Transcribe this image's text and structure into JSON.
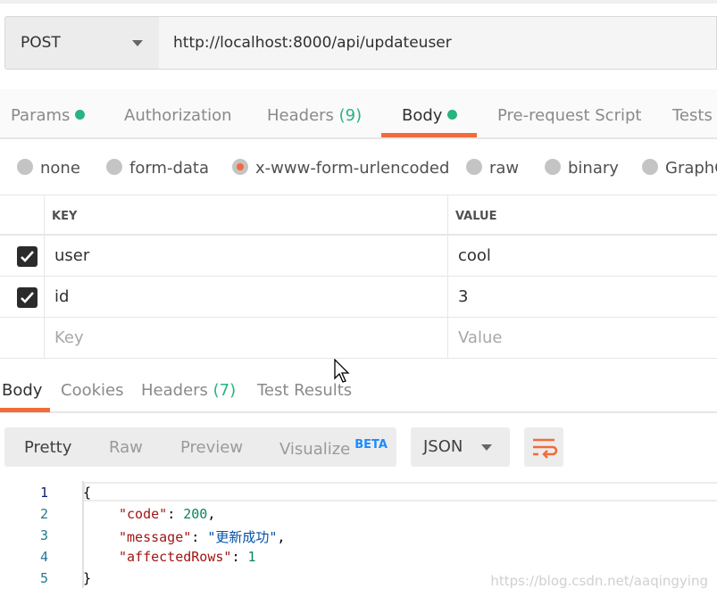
{
  "request": {
    "method": "POST",
    "url": "http://localhost:8000/api/updateuser"
  },
  "tabs": [
    {
      "label": "Params",
      "dot": true
    },
    {
      "label": "Authorization"
    },
    {
      "label": "Headers",
      "count": "(9)"
    },
    {
      "label": "Body",
      "dot": true,
      "active": true
    },
    {
      "label": "Pre-request Script"
    },
    {
      "label": "Tests"
    }
  ],
  "body_modes": [
    {
      "label": "none"
    },
    {
      "label": "form-data"
    },
    {
      "label": "x-www-form-urlencoded",
      "selected": true
    },
    {
      "label": "raw"
    },
    {
      "label": "binary"
    },
    {
      "label": "GraphQL"
    }
  ],
  "params_table": {
    "headers": [
      "KEY",
      "VALUE"
    ],
    "rows": [
      {
        "checked": true,
        "key": "user",
        "value": "cool"
      },
      {
        "checked": true,
        "key": "id",
        "value": "3"
      }
    ],
    "placeholder": {
      "key": "Key",
      "value": "Value"
    }
  },
  "response_tabs": [
    {
      "label": "Body",
      "active": true
    },
    {
      "label": "Cookies"
    },
    {
      "label": "Headers",
      "count": "(7)"
    },
    {
      "label": "Test Results"
    }
  ],
  "view_modes": {
    "pretty": "Pretty",
    "raw": "Raw",
    "preview": "Preview",
    "visualize": "Visualize",
    "beta": "BETA"
  },
  "format": "JSON",
  "code": {
    "line_numbers": [
      "1",
      "2",
      "3",
      "4",
      "5"
    ],
    "open": "{",
    "close": "}",
    "k1": "\"code\"",
    "v1": "200",
    "k2": "\"message\"",
    "v2": "\"更新成功\"",
    "k3": "\"affectedRows\"",
    "v3": "1"
  },
  "watermark": "https://blog.csdn.net/aaqingying",
  "colors": {
    "accent": "#f26b3a",
    "green": "#26b47f",
    "beta": "#1a8cff"
  }
}
